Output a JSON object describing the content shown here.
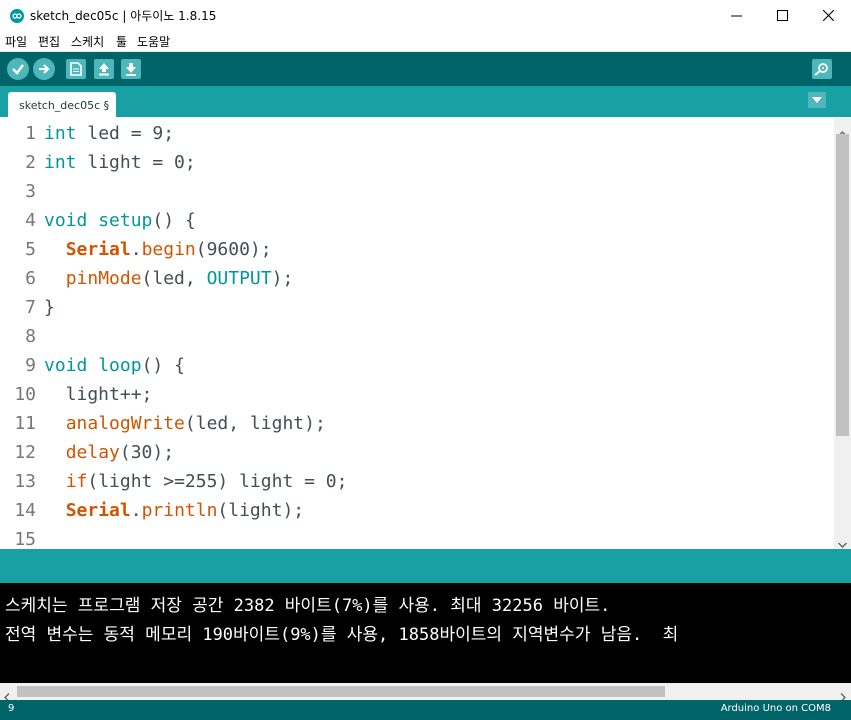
{
  "window": {
    "title": "sketch_dec05c | 아두이노 1.8.15",
    "controls": [
      "minimize-icon",
      "maximize-icon",
      "close-icon"
    ]
  },
  "menu": {
    "items": [
      "파일",
      "편집",
      "스케치",
      "툴",
      "도움말"
    ]
  },
  "toolbar": {
    "buttons": [
      "verify-icon",
      "upload-icon",
      "new-icon",
      "open-icon",
      "save-icon",
      "serial-monitor-icon"
    ]
  },
  "tabs": {
    "active": "sketch_dec05c §"
  },
  "editor": {
    "line_numbers": [
      "1",
      "2",
      "3",
      "4",
      "5",
      "6",
      "7",
      "8",
      "9",
      "10",
      "11",
      "12",
      "13",
      "14",
      "15"
    ],
    "tokens": {
      "l1": [
        "int",
        " led = 9;"
      ],
      "l2": [
        "int",
        " light = 0;"
      ],
      "l4": [
        "void",
        " ",
        "setup",
        "() {"
      ],
      "l5": [
        "  ",
        "Serial",
        ".",
        "begin",
        "(9600);"
      ],
      "l6": [
        "  ",
        "pinMode",
        "(led, ",
        "OUTPUT",
        ");"
      ],
      "l7": [
        "}"
      ],
      "l9": [
        "void",
        " ",
        "loop",
        "() {"
      ],
      "l10": [
        "  light++;"
      ],
      "l11": [
        "  ",
        "analogWrite",
        "(led, light);"
      ],
      "l12": [
        "  ",
        "delay",
        "(30);"
      ],
      "l13": [
        "  ",
        "if",
        "(light >=255) light = 0;"
      ],
      "l14": [
        "  ",
        "Serial",
        ".",
        "println",
        "(light);"
      ]
    }
  },
  "console": {
    "lines": [
      "스케치는 프로그램 저장 공간 2382 바이트(7%)를 사용. 최대 32256 바이트.",
      "전역 변수는 동적 메모리 190바이트(9%)를 사용, 1858바이트의 지역변수가 남음.  최"
    ]
  },
  "status": {
    "line": "9",
    "board": "Arduino Uno on COM8"
  },
  "colors": {
    "toolbar": "#006468",
    "tabbar": "#17a1a5",
    "keyword": "#00979c",
    "function": "#d35400",
    "console_bg": "#000000"
  }
}
